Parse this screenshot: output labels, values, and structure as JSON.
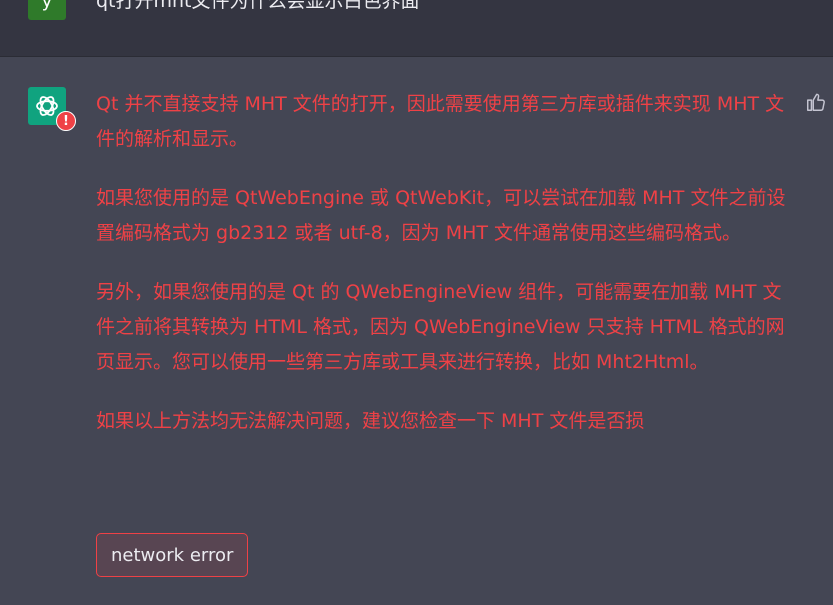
{
  "user": {
    "avatar_letter": "y",
    "message": "qt打开mht文件为什么会显示白色界面"
  },
  "assistant": {
    "paragraphs": [
      "Qt 并不直接支持 MHT 文件的打开，因此需要使用第三方库或插件来实现 MHT 文件的解析和显示。",
      "如果您使用的是 QtWebEngine 或 QtWebKit，可以尝试在加载 MHT 文件之前设置编码格式为 gb2312 或者 utf-8，因为 MHT 文件通常使用这些编码格式。",
      "另外，如果您使用的是 Qt 的 QWebEngineView 组件，可能需要在加载 MHT 文件之前将其转换为 HTML 格式，因为 QWebEngineView 只支持 HTML 格式的网页显示。您可以使用一些第三方库或工具来进行转换，比如 Mht2Html。",
      "如果以上方法均无法解决问题，建议您检查一下 MHT 文件是否损"
    ],
    "error_badge": "!",
    "error_button_label": "network error"
  },
  "colors": {
    "background": "#444654",
    "user_row": "#343541",
    "error": "#ef4146",
    "bot_avatar": "#10a37f",
    "user_avatar": "#2f7a2a"
  },
  "icons": {
    "bot_avatar": "openai-logo-icon",
    "feedback": "thumbs-up-icon"
  }
}
